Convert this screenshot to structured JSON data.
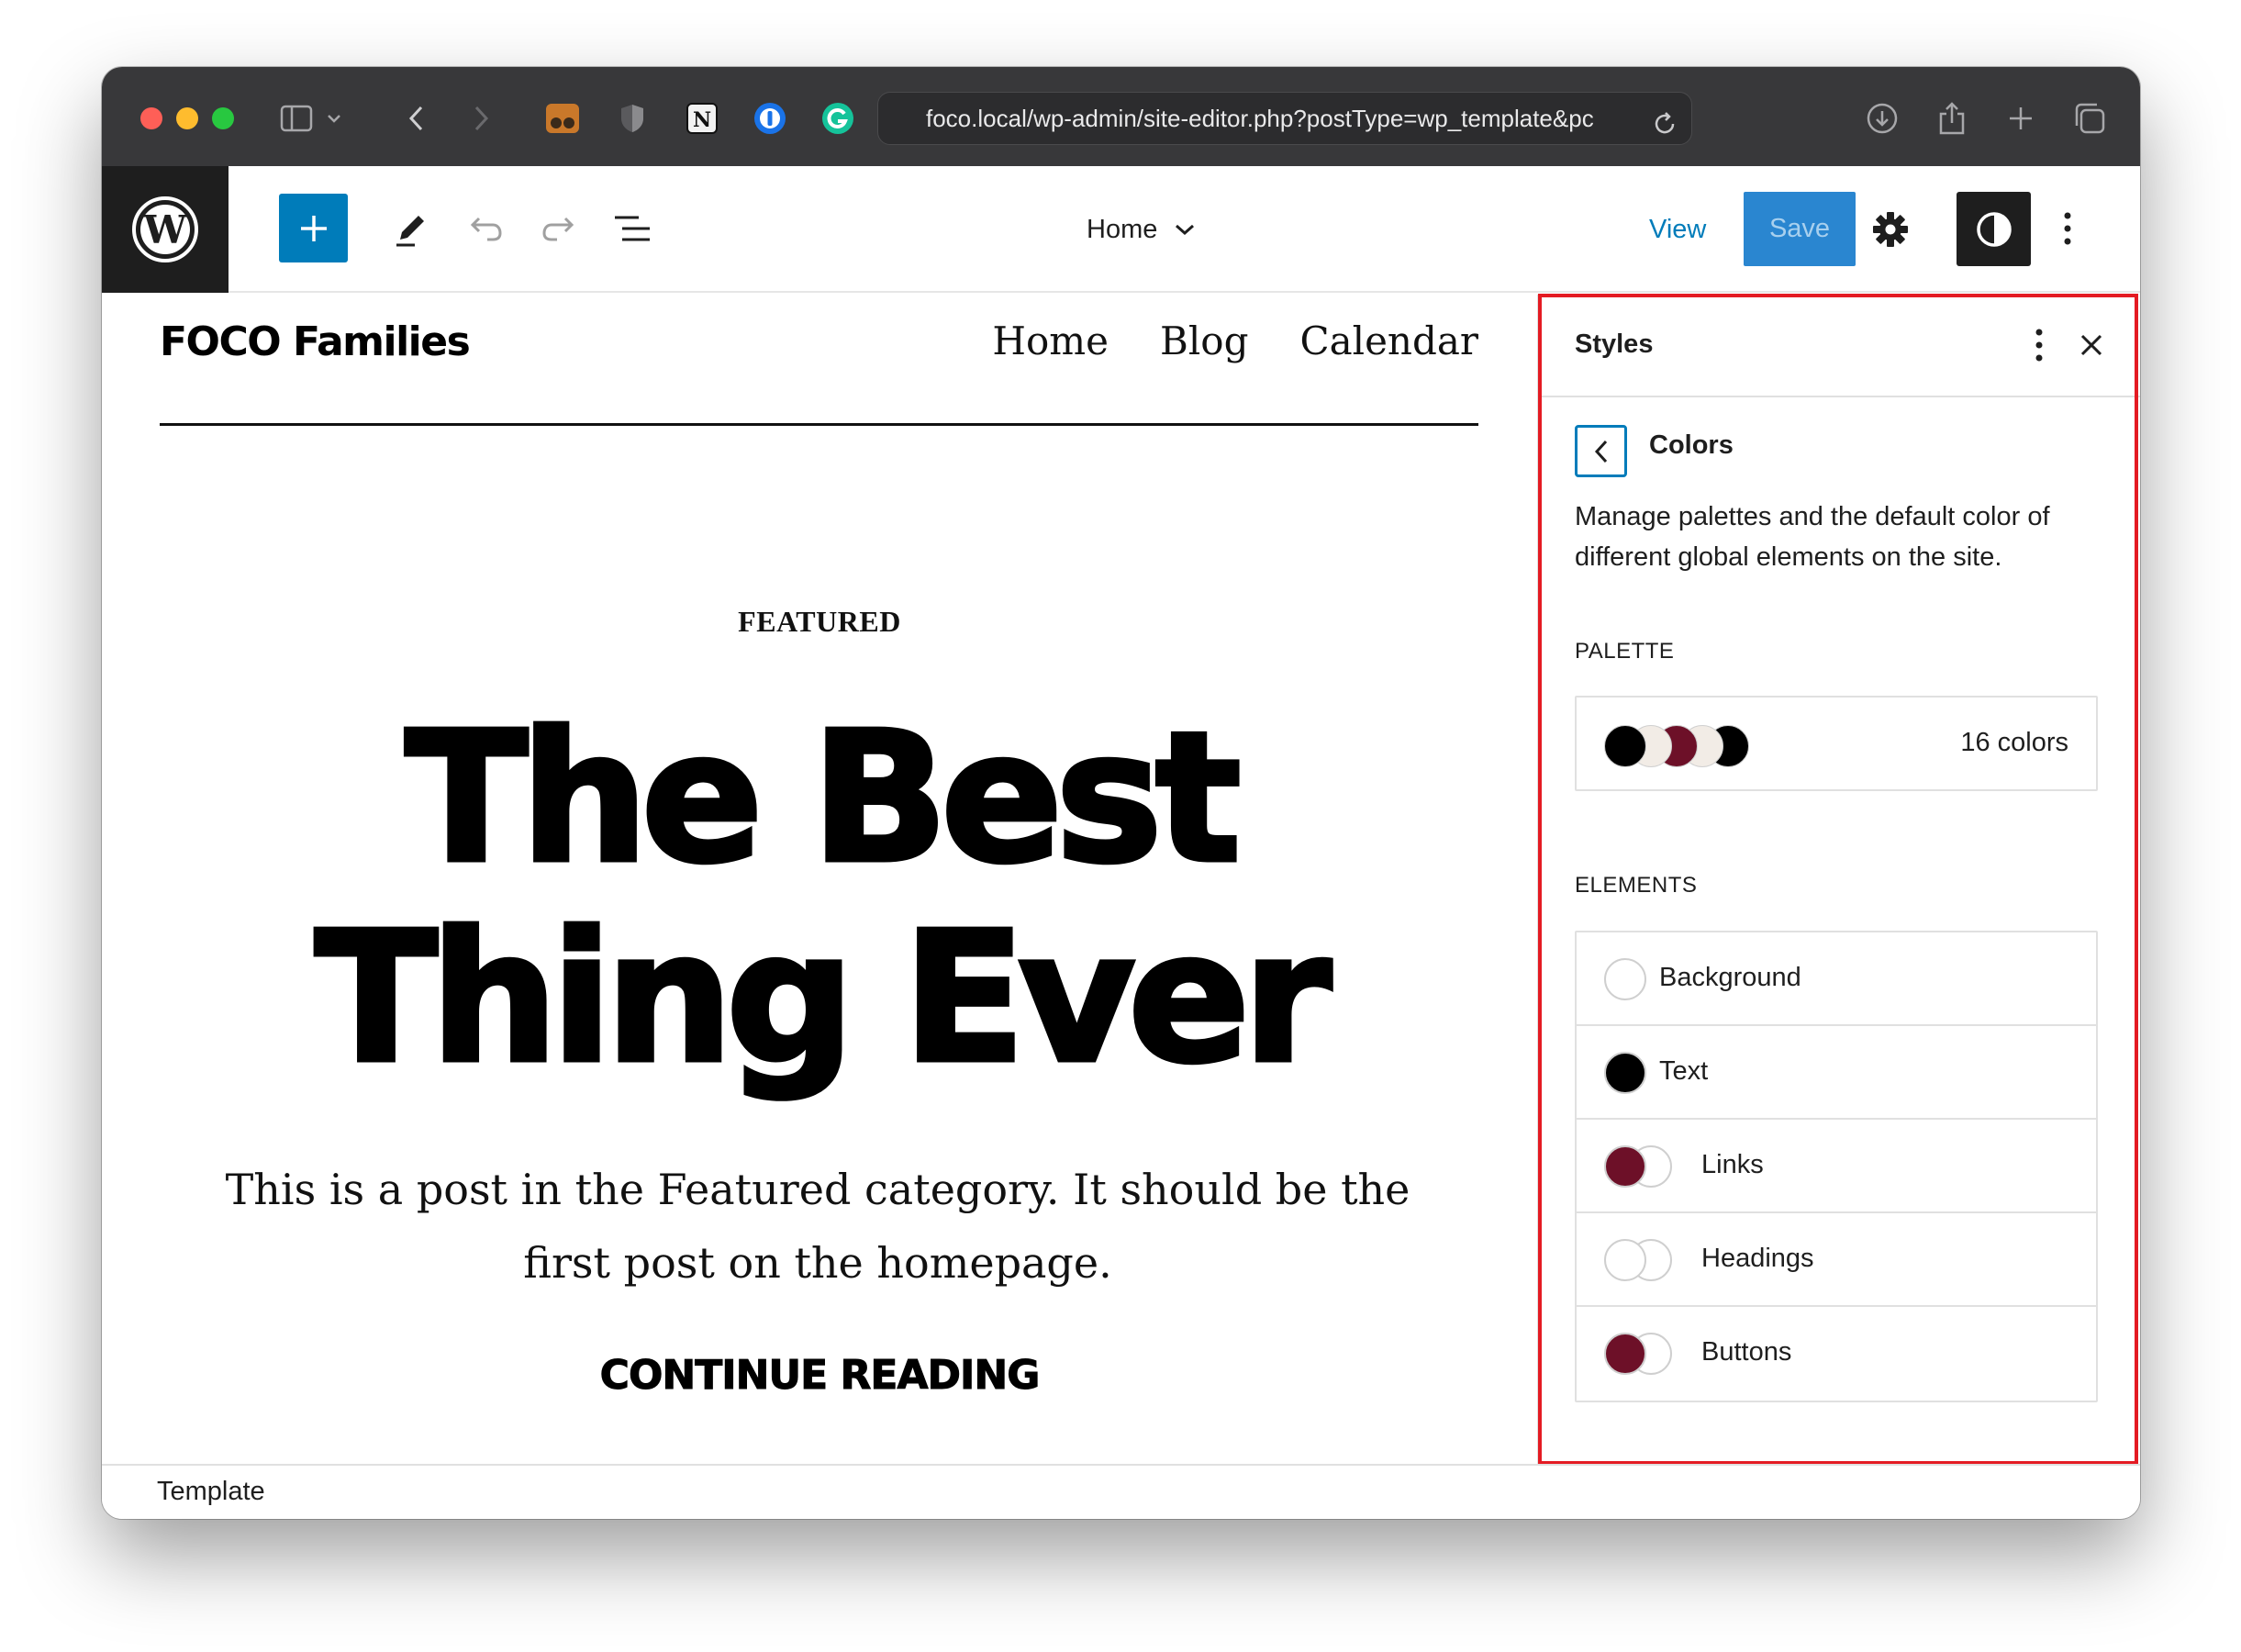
{
  "browser": {
    "url": "foco.local/wp-admin/site-editor.php?postType=wp_template&pc"
  },
  "toolbar": {
    "document_title": "Home",
    "view_label": "View",
    "save_label": "Save"
  },
  "site": {
    "title": "FOCO Families",
    "nav": [
      "Home",
      "Blog",
      "Calendar"
    ],
    "post_category": "FEATURED",
    "post_title_line1": "The Best",
    "post_title_line2": "Thing Ever",
    "excerpt": "This is a post in the Featured category. It should be the first post on the homepage.",
    "continue_label": "CONTINUE READING"
  },
  "status_bar": {
    "label": "Template"
  },
  "sidebar": {
    "title": "Styles",
    "panel_title": "Colors",
    "description": "Manage palettes and the default color of different global elements on the site.",
    "palette_heading": "PALETTE",
    "palette_count": "16 colors",
    "palette_swatches": [
      "#000000",
      "#f2ece6",
      "#6d1028",
      "#f2ece6",
      "#000000"
    ],
    "elements_heading": "ELEMENTS",
    "elements": [
      {
        "label": "Background",
        "colors": [
          "#ffffff"
        ]
      },
      {
        "label": "Text",
        "colors": [
          "#000000"
        ]
      },
      {
        "label": "Links",
        "colors": [
          "#6d1028",
          "#ffffff"
        ]
      },
      {
        "label": "Headings",
        "colors": [
          "#ffffff",
          "#ffffff"
        ]
      },
      {
        "label": "Buttons",
        "colors": [
          "#6d1028",
          "#ffffff"
        ]
      }
    ]
  },
  "colors": {
    "wp_blue": "#007cba",
    "highlight": "#e41b23",
    "accent_maroon": "#6d1028"
  }
}
